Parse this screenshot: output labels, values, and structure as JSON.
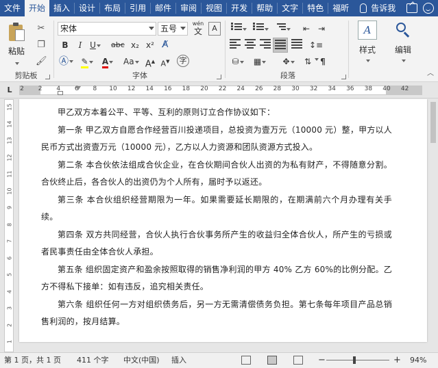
{
  "tabs": [
    "文件",
    "开始",
    "插入",
    "设计",
    "布局",
    "引用",
    "邮件",
    "审阅",
    "视图",
    "开发",
    "帮助",
    "文字",
    "特色",
    "福昕"
  ],
  "active_tab": 1,
  "tell_me": "告诉我",
  "clipboard": {
    "paste_label": "粘贴",
    "group_label": "剪贴板"
  },
  "font": {
    "name": "宋体",
    "size": "五号",
    "group_label": "字体",
    "bold": "B",
    "italic": "I",
    "underline": "U",
    "strike": "abc",
    "subscript": "x₂",
    "superscript": "x²",
    "wen": "wén",
    "wen_char": "文",
    "highlight_color": "#ffff00",
    "font_color": "#e00000"
  },
  "paragraph": {
    "group_label": "段落"
  },
  "styles": {
    "label": "样式"
  },
  "editing": {
    "label": "编辑"
  },
  "ruler": {
    "ticks": [
      "2",
      "2",
      "4",
      "6",
      "8",
      "10",
      "12",
      "14",
      "16",
      "18",
      "20",
      "22",
      "24",
      "26",
      "28",
      "30",
      "32",
      "34",
      "36",
      "38",
      "40",
      "42"
    ]
  },
  "vruler": {
    "ticks": [
      "15",
      "14",
      "13",
      "12",
      "11",
      "10",
      "9",
      "8",
      "7",
      "6",
      "5",
      "4",
      "3",
      "2",
      "1"
    ]
  },
  "document": {
    "paragraphs": [
      "甲乙双方本着公平、平等、互利的原则订立合作协议如下：",
      "第一条 甲乙双方自愿合作经营百川投递项目，总投资为壹万元（10000 元）整，甲方以人民币方式出资壹万元（10000 元），乙方以人力资源和团队资源方式投入。",
      "第二条 本合伙依法组成合伙企业，在合伙期间合伙人出资的为私有财产，不得随意分割。合伙终止后，各合伙人的出资仍为个人所有，届时予以返还。",
      "第三条 本合伙组织经营期限为一年。如果需要延长期限的，在期满前六个月办理有关手续。",
      "第四条 双方共同经营，合伙人执行合伙事务所产生的收益归全体合伙人，所产生的亏损或者民事责任由全体合伙人承担。",
      "第五条 组织固定资产和盈余按照取得的销售净利润的甲方 40% 乙方 60%的比例分配。乙方不得私下接单：如有违反，追究相关责任。",
      "第六条 组织任何一方对组织债务后，另一方无需清偿债务负担。第七条每年项目产品总销售利润的，按月结算。"
    ]
  },
  "status": {
    "page": "第 1 页，共 1 页",
    "words": "411 个字",
    "language": "中文(中国)",
    "mode": "插入",
    "zoom": "94%",
    "minus": "−",
    "plus": "+"
  },
  "colors": {
    "brand": "#2b579a"
  }
}
